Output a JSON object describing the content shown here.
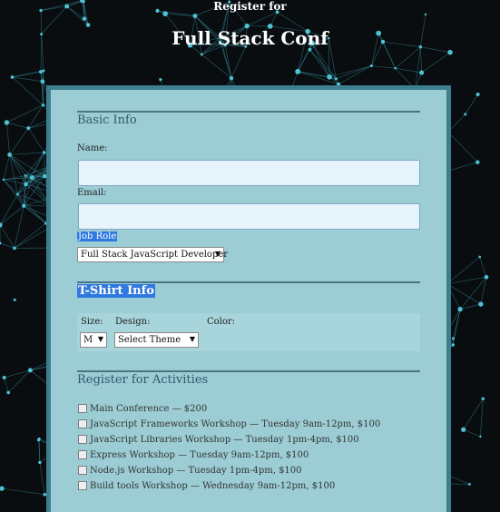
{
  "header": {
    "pre": "Register for",
    "title": "Full Stack Conf"
  },
  "basic": {
    "title": "Basic Info",
    "name_label": "Name:",
    "email_label": "Email:",
    "job_label": "Job Role",
    "job_value": "Full Stack JavaScript Developer"
  },
  "tshirt": {
    "title": "T-Shirt Info",
    "size_label": "Size:",
    "size_value": "M",
    "design_label": "Design:",
    "design_value": "Select Theme",
    "color_label": "Color:"
  },
  "activities": {
    "title": "Register for Activities",
    "items": [
      "Main Conference — $200",
      "JavaScript Frameworks Workshop — Tuesday 9am-12pm, $100",
      "JavaScript Libraries Workshop — Tuesday 1pm-4pm, $100",
      "Express Workshop — Tuesday 9am-12pm, $100",
      "Node.js Workshop — Tuesday 1pm-4pm, $100",
      "Build tools Workshop — Wednesday 9am-12pm, $100"
    ]
  },
  "icons": {
    "dropdown": "chevron-down-icon",
    "checkbox": "checkbox-icon"
  },
  "colors": {
    "card": "#9ccdd5",
    "card_border": "#3e7f8f",
    "section_title": "#33586a",
    "selection": "#2f78e0"
  }
}
